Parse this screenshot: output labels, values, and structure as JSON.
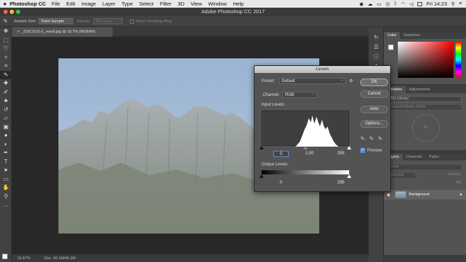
{
  "menubar": {
    "app": "Photoshop CC",
    "items": [
      "File",
      "Edit",
      "Image",
      "Layer",
      "Type",
      "Select",
      "Filter",
      "3D",
      "View",
      "Window",
      "Help"
    ],
    "clock": "Fri 14:23"
  },
  "window": {
    "title": "Adobe Photoshop CC 2017"
  },
  "options": {
    "sample_size_label": "Sample Size:",
    "sample_size_value": "Point Sample",
    "sample_label": "Sample:",
    "sample_value": "All Layers",
    "sampling_ring": "Show Sampling Ring"
  },
  "document": {
    "tab": "_DSC3110-2_result.jpg @ 16.7% (RGB/8#)",
    "zoom": "16.67%",
    "doc_size": "Doc: 40.1M/40.1M"
  },
  "panels": {
    "color_tabs": [
      "Color",
      "Swatches"
    ],
    "library_tabs": [
      "Libraries",
      "Adjustments"
    ],
    "library_select": "My Library",
    "library_search": "Search Adobe Stock",
    "layer_tabs": [
      "Layers",
      "Channels",
      "Paths"
    ],
    "kind": "Kind",
    "blend": "Normal",
    "opacity_label": "Opacity:",
    "fill_label": "Fill:",
    "layer_name": "Background"
  },
  "levels": {
    "title": "Levels",
    "preset_label": "Preset:",
    "preset_value": "Default",
    "channel_label": "Channel:",
    "channel_value": "RGB",
    "input_label": "Input Levels:",
    "input_black": "0",
    "input_gamma": "1.00",
    "input_white": "255",
    "output_label": "Output Levels:",
    "output_black": "0",
    "output_white": "255",
    "buttons": {
      "ok": "OK",
      "cancel": "Cancel",
      "auto": "Auto",
      "options": "Options..."
    },
    "preview_label": "Preview",
    "preview_checked": true
  }
}
